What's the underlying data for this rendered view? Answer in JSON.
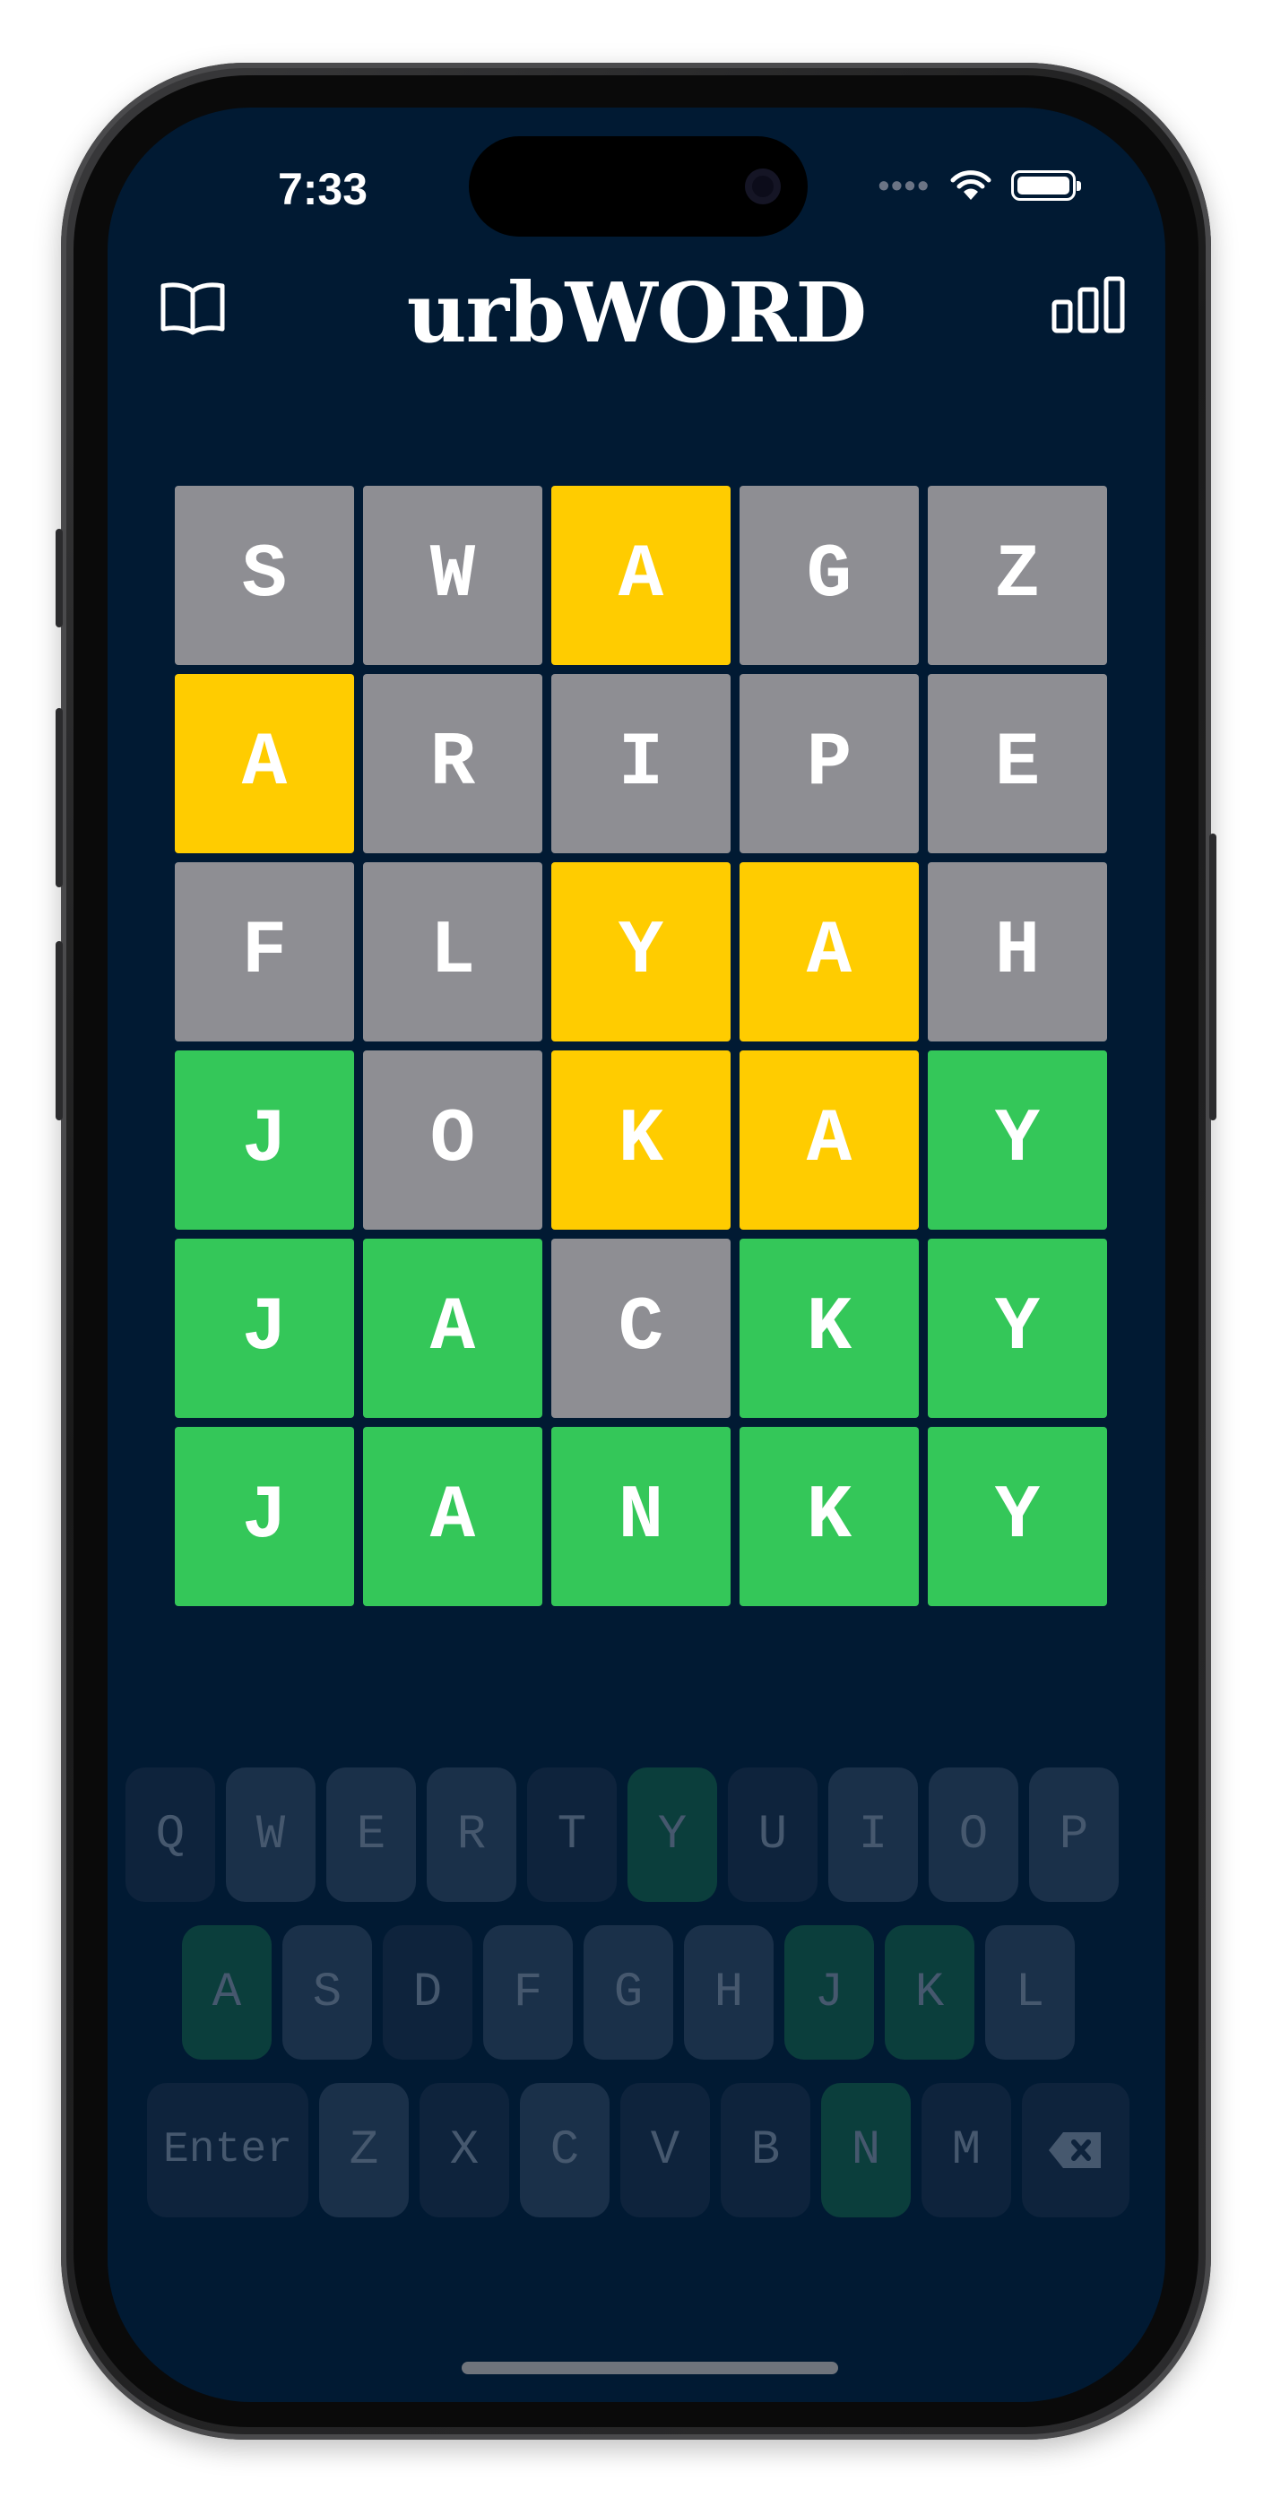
{
  "status": {
    "time": "7:33"
  },
  "header": {
    "title": "urbWORD",
    "left_icon": "book-icon",
    "right_icon": "stats-icon"
  },
  "colors": {
    "background": "#011a33",
    "absent": "#8e8e93",
    "present": "#ffcc00",
    "correct": "#34c759"
  },
  "board": [
    [
      {
        "l": "S",
        "s": "absent"
      },
      {
        "l": "W",
        "s": "absent"
      },
      {
        "l": "A",
        "s": "present"
      },
      {
        "l": "G",
        "s": "absent"
      },
      {
        "l": "Z",
        "s": "absent"
      }
    ],
    [
      {
        "l": "A",
        "s": "present"
      },
      {
        "l": "R",
        "s": "absent"
      },
      {
        "l": "I",
        "s": "absent"
      },
      {
        "l": "P",
        "s": "absent"
      },
      {
        "l": "E",
        "s": "absent"
      }
    ],
    [
      {
        "l": "F",
        "s": "absent"
      },
      {
        "l": "L",
        "s": "absent"
      },
      {
        "l": "Y",
        "s": "present"
      },
      {
        "l": "A",
        "s": "present"
      },
      {
        "l": "H",
        "s": "absent"
      }
    ],
    [
      {
        "l": "J",
        "s": "correct"
      },
      {
        "l": "O",
        "s": "absent"
      },
      {
        "l": "K",
        "s": "present"
      },
      {
        "l": "A",
        "s": "present"
      },
      {
        "l": "Y",
        "s": "correct"
      }
    ],
    [
      {
        "l": "J",
        "s": "correct"
      },
      {
        "l": "A",
        "s": "correct"
      },
      {
        "l": "C",
        "s": "absent"
      },
      {
        "l": "K",
        "s": "correct"
      },
      {
        "l": "Y",
        "s": "correct"
      }
    ],
    [
      {
        "l": "J",
        "s": "correct"
      },
      {
        "l": "A",
        "s": "correct"
      },
      {
        "l": "N",
        "s": "correct"
      },
      {
        "l": "K",
        "s": "correct"
      },
      {
        "l": "Y",
        "s": "correct"
      }
    ]
  ],
  "keyboard": {
    "rows": [
      [
        {
          "k": "Q",
          "s": "absent"
        },
        {
          "k": "W",
          "s": "unused"
        },
        {
          "k": "E",
          "s": "unused"
        },
        {
          "k": "R",
          "s": "unused"
        },
        {
          "k": "T",
          "s": "absent"
        },
        {
          "k": "Y",
          "s": "correct"
        },
        {
          "k": "U",
          "s": "absent"
        },
        {
          "k": "I",
          "s": "unused"
        },
        {
          "k": "O",
          "s": "unused"
        },
        {
          "k": "P",
          "s": "unused"
        }
      ],
      [
        {
          "k": "A",
          "s": "correct"
        },
        {
          "k": "S",
          "s": "unused"
        },
        {
          "k": "D",
          "s": "absent"
        },
        {
          "k": "F",
          "s": "unused"
        },
        {
          "k": "G",
          "s": "unused"
        },
        {
          "k": "H",
          "s": "unused"
        },
        {
          "k": "J",
          "s": "correct"
        },
        {
          "k": "K",
          "s": "correct"
        },
        {
          "k": "L",
          "s": "unused"
        }
      ],
      [
        {
          "k": "Enter",
          "s": "absent"
        },
        {
          "k": "Z",
          "s": "unused"
        },
        {
          "k": "X",
          "s": "absent"
        },
        {
          "k": "C",
          "s": "unused"
        },
        {
          "k": "V",
          "s": "absent"
        },
        {
          "k": "B",
          "s": "absent"
        },
        {
          "k": "N",
          "s": "correct"
        },
        {
          "k": "M",
          "s": "absent"
        },
        {
          "k": "backspace",
          "s": "absent"
        }
      ]
    ]
  }
}
